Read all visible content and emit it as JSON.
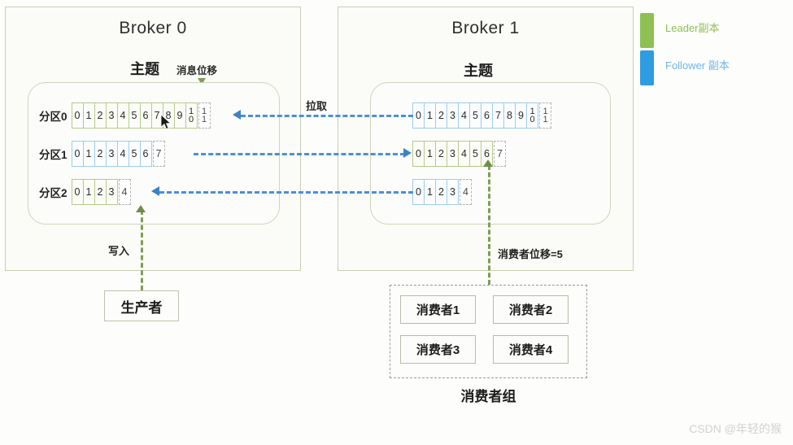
{
  "diagram": {
    "title_broker0": "Broker 0",
    "title_broker1": "Broker 1",
    "topic_label": "主题",
    "message_offset_label": "消息位移",
    "pull_label": "拉取",
    "write_label": "写入",
    "consumer_offset_label": "消费者位移=5",
    "producer_label": "生产者",
    "consumer_group_label": "消费者组"
  },
  "brokers": [
    {
      "name": "Broker 0",
      "partitions": [
        {
          "label": "分区0",
          "role": "leader",
          "color": "#8DC153",
          "cells": [
            "0",
            "1",
            "2",
            "3",
            "4",
            "5",
            "6",
            "7",
            "8",
            "9",
            "10"
          ],
          "ghost": "11"
        },
        {
          "label": "分区1",
          "role": "follower",
          "color": "#2D9CE0",
          "cells": [
            "0",
            "1",
            "2",
            "3",
            "4",
            "5",
            "6"
          ],
          "ghost": "7"
        },
        {
          "label": "分区2",
          "role": "leader",
          "color": "#8DC153",
          "cells": [
            "0",
            "1",
            "2",
            "3"
          ],
          "ghost": "4"
        }
      ]
    },
    {
      "name": "Broker 1",
      "partitions": [
        {
          "label": "分区0",
          "role": "follower",
          "color": "#2D9CE0",
          "cells": [
            "0",
            "1",
            "2",
            "3",
            "4",
            "5",
            "6",
            "7",
            "8",
            "9",
            "10"
          ],
          "ghost": "11"
        },
        {
          "label": "分区1",
          "role": "leader",
          "color": "#8DC153",
          "cells": [
            "0",
            "1",
            "2",
            "3",
            "4",
            "5",
            "6"
          ],
          "ghost": "7"
        },
        {
          "label": "分区2",
          "role": "follower",
          "color": "#2D9CE0",
          "cells": [
            "0",
            "1",
            "2",
            "3"
          ],
          "ghost": "4"
        }
      ]
    }
  ],
  "replication_arrows": [
    {
      "direction": "left",
      "label": "拉取"
    },
    {
      "direction": "right",
      "label": ""
    },
    {
      "direction": "left",
      "label": ""
    }
  ],
  "consumers": [
    {
      "label": "消费者1"
    },
    {
      "label": "消费者2"
    },
    {
      "label": "消费者3"
    },
    {
      "label": "消费者4"
    }
  ],
  "legend": [
    {
      "label": "Leader副本",
      "color": "#8DC153",
      "text_color": "#8DC153"
    },
    {
      "label": "Follower 副本",
      "color": "#2D9CE0",
      "text_color": "#6FB6E8"
    }
  ],
  "watermark": "CSDN @年轻的猴"
}
